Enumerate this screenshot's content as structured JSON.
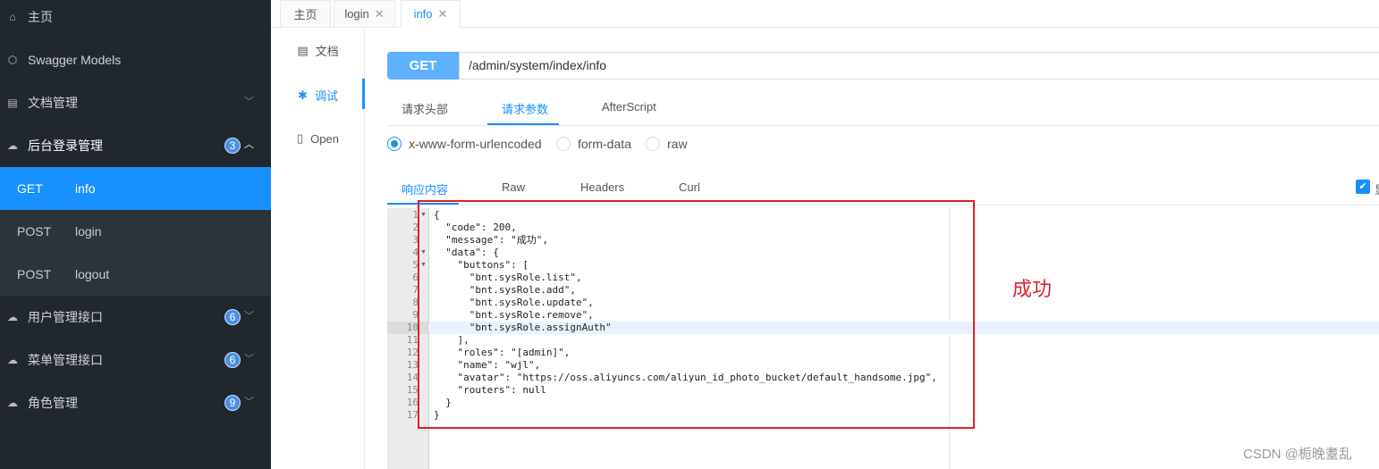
{
  "sidebar": {
    "items": [
      {
        "label": "主页",
        "icon": "home-icon"
      },
      {
        "label": "Swagger Models",
        "icon": "cube-icon"
      },
      {
        "label": "文档管理",
        "icon": "doc-settings-icon"
      },
      {
        "label": "后台登录管理",
        "icon": "cloud-icon",
        "badge": "3"
      },
      {
        "label": "用户管理接口",
        "icon": "cloud-icon",
        "badge": "6"
      },
      {
        "label": "菜单管理接口",
        "icon": "cloud-icon",
        "badge": "6"
      },
      {
        "label": "角色管理",
        "icon": "cloud-icon",
        "badge": "9"
      }
    ],
    "sub": [
      {
        "method": "GET",
        "name": "info"
      },
      {
        "method": "POST",
        "name": "login"
      },
      {
        "method": "POST",
        "name": "logout"
      }
    ]
  },
  "tabs": [
    {
      "label": "主页"
    },
    {
      "label": "login"
    },
    {
      "label": "info"
    }
  ],
  "subnav": [
    {
      "label": "文档"
    },
    {
      "label": "调试"
    },
    {
      "label": "Open"
    }
  ],
  "request": {
    "method": "GET",
    "url": "/admin/system/index/info",
    "tabs": [
      "请求头部",
      "请求参数",
      "AfterScript"
    ],
    "content_types": [
      "x-www-form-urlencoded",
      "form-data",
      "raw"
    ]
  },
  "response": {
    "tabs": [
      "响应内容",
      "Raw",
      "Headers",
      "Curl"
    ],
    "checkbox_label": "显"
  },
  "code_lines": [
    "{",
    "  \"code\": 200,",
    "  \"message\": \"成功\",",
    "  \"data\": {",
    "    \"buttons\": [",
    "      \"bnt.sysRole.list\",",
    "      \"bnt.sysRole.add\",",
    "      \"bnt.sysRole.update\",",
    "      \"bnt.sysRole.remove\",",
    "      \"bnt.sysRole.assignAuth\"",
    "    ],",
    "    \"roles\": \"[admin]\",",
    "    \"name\": \"wjl\",",
    "    \"avatar\": \"https://oss.aliyuncs.com/aliyun_id_photo_bucket/default_handsome.jpg\",",
    "    \"routers\": null",
    "  }",
    "}"
  ],
  "annotation": "成功",
  "watermark": "CSDN @栀晚耋乱",
  "colors": {
    "accent": "#1890ff",
    "sidebar": "#20272e",
    "annotation": "#e0202a"
  }
}
